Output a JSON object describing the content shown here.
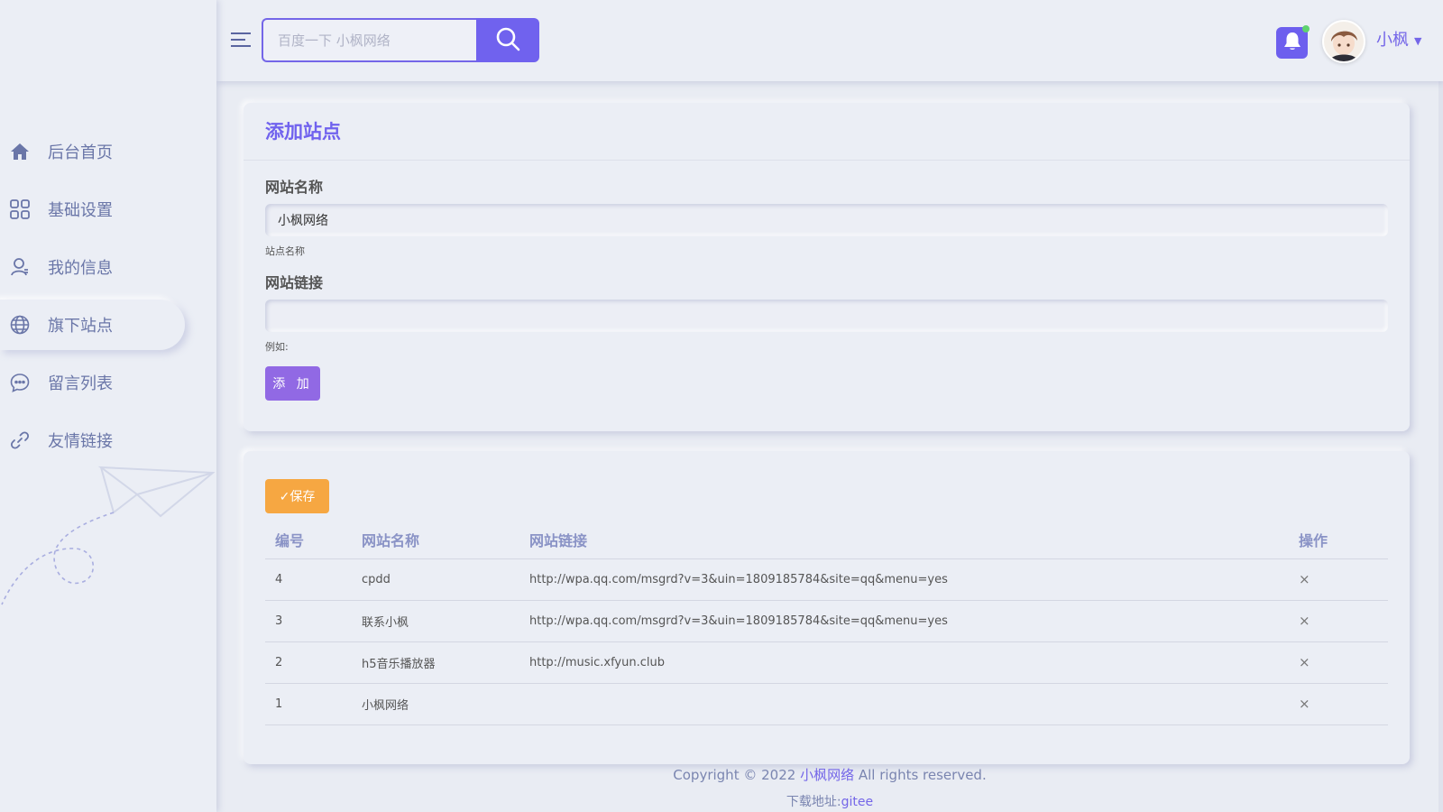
{
  "sidebar": {
    "items": [
      {
        "label": "后台首页",
        "icon": "home-icon"
      },
      {
        "label": "基础设置",
        "icon": "grid-icon"
      },
      {
        "label": "我的信息",
        "icon": "user-icon"
      },
      {
        "label": "旗下站点",
        "icon": "globe-icon",
        "active": true
      },
      {
        "label": "留言列表",
        "icon": "chat-icon"
      },
      {
        "label": "友情链接",
        "icon": "link-icon"
      }
    ]
  },
  "header": {
    "search_placeholder": "百度一下 小枫网络",
    "username": "小枫",
    "accent_color": "#7062ee"
  },
  "add_site": {
    "title": "添加站点",
    "name_label": "网站名称",
    "name_value": "小枫网络",
    "name_help": "站点名称",
    "url_label": "网站链接",
    "url_value": "",
    "url_help": "例如:",
    "add_button": "添 加"
  },
  "sites": {
    "save_button": "✓保存",
    "columns": [
      "编号",
      "网站名称",
      "网站链接",
      "操作"
    ],
    "rows": [
      {
        "id": "4",
        "name": "cpdd",
        "url": "http://wpa.qq.com/msgrd?v=3&uin=1809185784&site=qq&menu=yes",
        "action": "×"
      },
      {
        "id": "3",
        "name": "联系小枫",
        "url": "http://wpa.qq.com/msgrd?v=3&uin=1809185784&site=qq&menu=yes",
        "action": "×"
      },
      {
        "id": "2",
        "name": "h5音乐播放器",
        "url": "http://music.xfyun.club",
        "action": "×"
      },
      {
        "id": "1",
        "name": "小枫网络",
        "url": "",
        "action": "×"
      }
    ]
  },
  "footer": {
    "copyright_prefix": "Copyright © 2022 ",
    "brand": "小枫网络",
    "copyright_suffix": " All rights reserved.",
    "download_label": "下载地址:",
    "download_link": "gitee"
  }
}
